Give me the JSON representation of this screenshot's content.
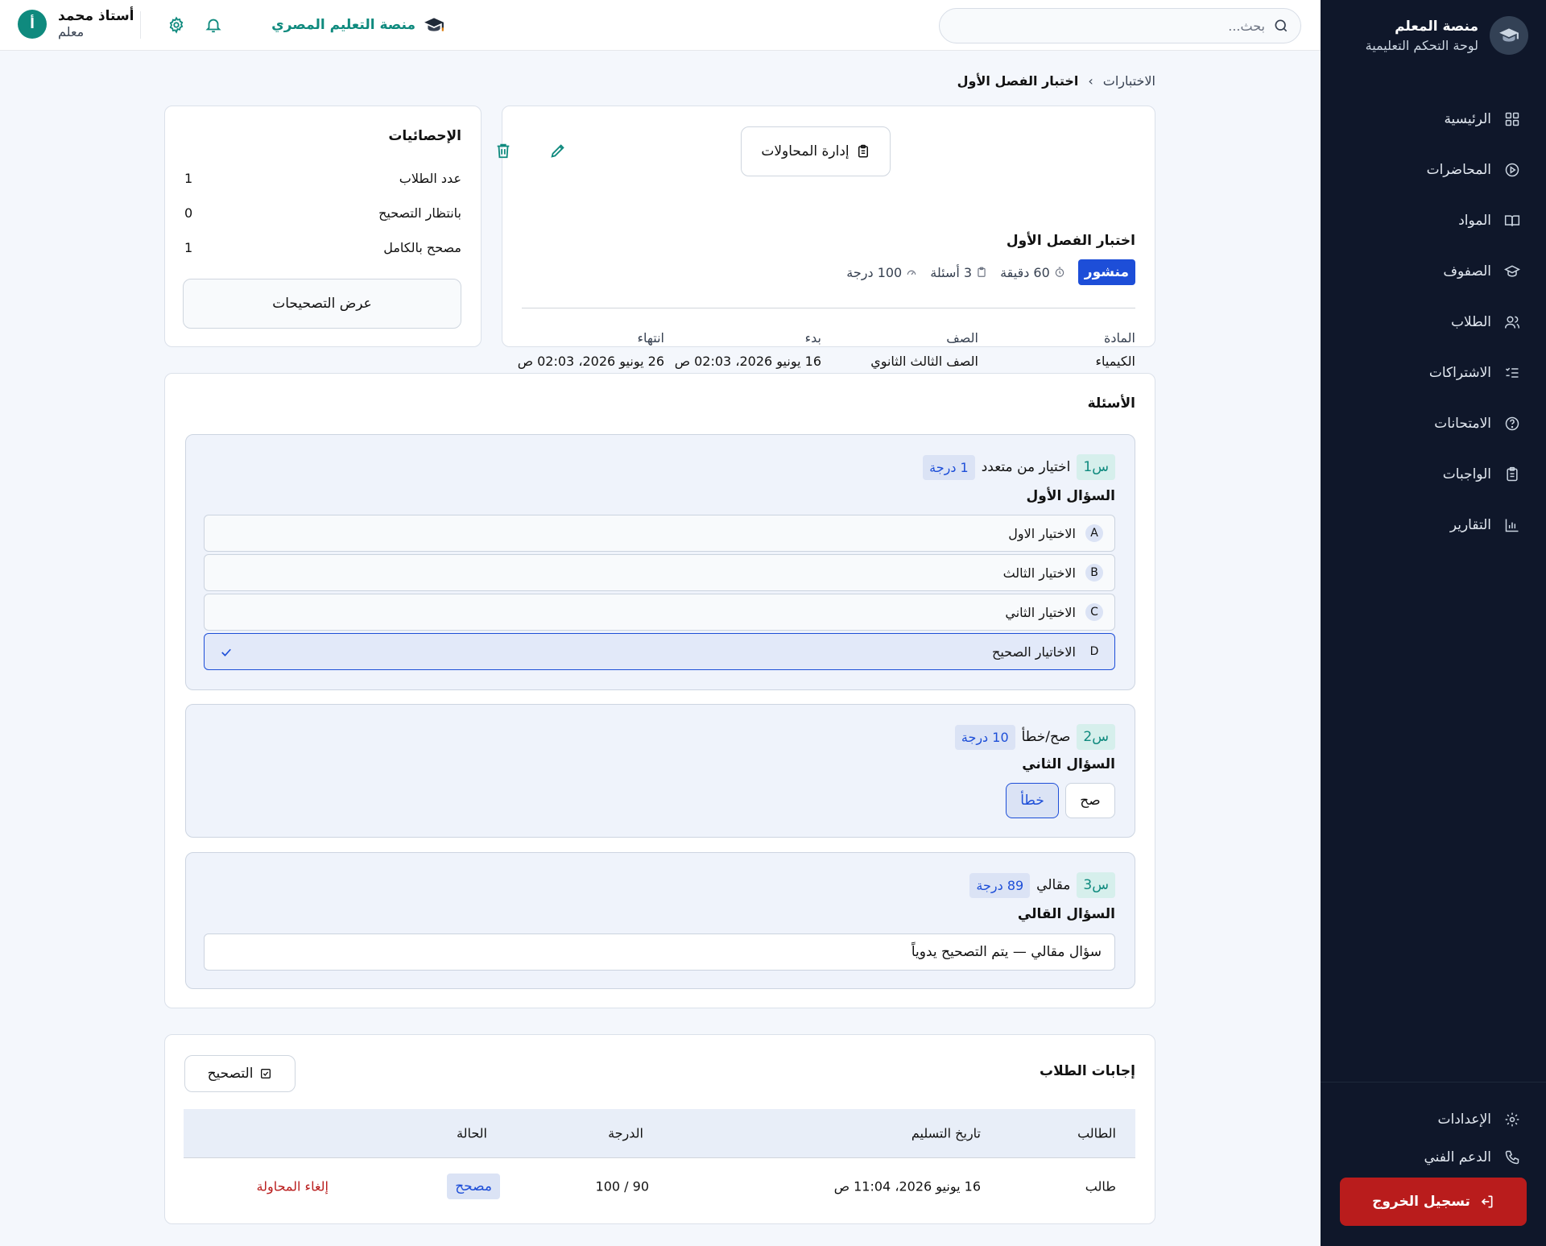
{
  "sidebar": {
    "title": "منصة المعلم",
    "subtitle": "لوحة التحكم التعليمية",
    "items": [
      {
        "label": "الرئيسية"
      },
      {
        "label": "المحاضرات"
      },
      {
        "label": "المواد"
      },
      {
        "label": "الصفوف"
      },
      {
        "label": "الطلاب"
      },
      {
        "label": "الاشتراكات"
      },
      {
        "label": "الامتحانات"
      },
      {
        "label": "الواجبات"
      },
      {
        "label": "التقارير"
      }
    ],
    "footer": [
      {
        "label": "الإعدادات"
      },
      {
        "label": "الدعم الفني"
      }
    ],
    "logout": "تسجيل الخروج"
  },
  "topbar": {
    "search_placeholder": "بحث...",
    "platform_name": "منصة التعليم المصري",
    "user_name": "أستاذ محمد",
    "user_role": "معلم",
    "avatar_letter": "أ"
  },
  "breadcrumb": {
    "parent": "الاختبارات",
    "separator": "›",
    "current": "اختبار الفصل الأول"
  },
  "exam": {
    "title": "اختبار الفصل الأول",
    "status": "منشور",
    "duration": "60 دقيقة",
    "questions_count": "3 أسئلة",
    "total_score": "100 درجة",
    "manage_attempts": "إدارة المحاولات",
    "info": [
      {
        "label": "المادة",
        "value": "الكيمياء"
      },
      {
        "label": "الصف",
        "value": "الصف الثالث الثانوي"
      },
      {
        "label": "بدء",
        "value": "16 يونيو 2026، 02:03 ص"
      },
      {
        "label": "انتهاء",
        "value": "26 يونيو 2026، 02:03 ص"
      }
    ]
  },
  "stats": {
    "title": "الإحصائيات",
    "rows": [
      {
        "label": "عدد الطلاب",
        "value": "1"
      },
      {
        "label": "بانتظار التصحيح",
        "value": "0"
      },
      {
        "label": "مصحح بالكامل",
        "value": "1"
      }
    ],
    "view_button": "عرض التصحيحات"
  },
  "questions": {
    "title": "الأسئلة",
    "q1": {
      "num": "س1",
      "type": "اختيار من متعدد",
      "score": "1 درجة",
      "text": "السؤال الأول",
      "options": [
        {
          "letter": "A",
          "text": "الاختيار الاول"
        },
        {
          "letter": "B",
          "text": "الاختيار الثالث"
        },
        {
          "letter": "C",
          "text": "الاختيار الثاني"
        },
        {
          "letter": "D",
          "text": "الاخاتيار الصحيح"
        }
      ]
    },
    "q2": {
      "num": "س2",
      "type": "صح/خطأ",
      "score": "10 درجة",
      "text": "السؤال الثاني",
      "true_label": "صح",
      "false_label": "خطأ"
    },
    "q3": {
      "num": "س3",
      "type": "مقالي",
      "score": "89 درجة",
      "text": "السؤال القالي",
      "note": "سؤال مقالي — يتم التصحيح يدوياً"
    }
  },
  "answers": {
    "title": "إجابات الطلاب",
    "grade_button": "التصحيح",
    "headers": {
      "student": "الطالب",
      "date": "تاريخ التسليم",
      "score": "الدرجة",
      "status": "الحالة"
    },
    "rows": [
      {
        "student": "طالب",
        "date": "16 يونيو 2026، 11:04 ص",
        "score": "90 / 100",
        "status": "مصحح",
        "action": "إلغاء المحاولة"
      }
    ]
  }
}
